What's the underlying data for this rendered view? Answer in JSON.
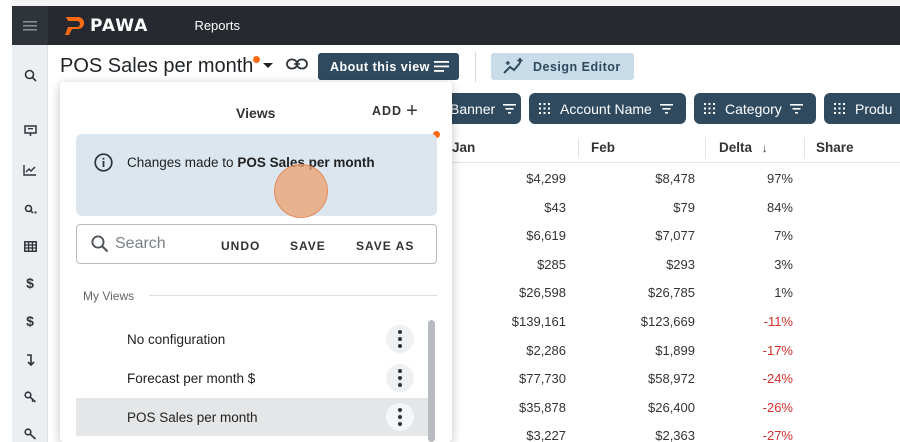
{
  "app": {
    "brand": "PAWA",
    "nav_reports": "Reports"
  },
  "header": {
    "title": "POS Sales per month",
    "about_label": "About this view",
    "design_label": "Design Editor"
  },
  "filters": [
    {
      "label": "Banner"
    },
    {
      "label": "Account Name"
    },
    {
      "label": "Category"
    },
    {
      "label": "Produ"
    }
  ],
  "table": {
    "headers": [
      "Jan",
      "Feb",
      "Delta",
      "Share"
    ],
    "sort_indicator": "↓",
    "rows": [
      {
        "jan": "$4,299",
        "feb": "$8,478",
        "delta": "97%",
        "negative": false
      },
      {
        "jan": "$43",
        "feb": "$79",
        "delta": "84%",
        "negative": false
      },
      {
        "jan": "$6,619",
        "feb": "$7,077",
        "delta": "7%",
        "negative": false
      },
      {
        "jan": "$285",
        "feb": "$293",
        "delta": "3%",
        "negative": false
      },
      {
        "jan": "$26,598",
        "feb": "$26,785",
        "delta": "1%",
        "negative": false
      },
      {
        "jan": "$139,161",
        "feb": "$123,669",
        "delta": "-11%",
        "negative": true
      },
      {
        "jan": "$2,286",
        "feb": "$1,899",
        "delta": "-17%",
        "negative": true
      },
      {
        "jan": "$77,730",
        "feb": "$58,972",
        "delta": "-24%",
        "negative": true
      },
      {
        "jan": "$35,878",
        "feb": "$26,400",
        "delta": "-26%",
        "negative": true
      },
      {
        "jan": "$3,227",
        "feb": "$2,363",
        "delta": "-27%",
        "negative": true
      }
    ]
  },
  "views_panel": {
    "title": "Views",
    "add_label": "ADD",
    "notice_prefix": "Changes made to ",
    "notice_view": "POS Sales per month",
    "undo_label": "UNDO",
    "save_label": "SAVE",
    "save_as_label": "SAVE AS",
    "search_placeholder": "Search",
    "section_label": "My Views",
    "items": [
      {
        "label": "No configuration",
        "active": false
      },
      {
        "label": "Forecast per month $",
        "active": false
      },
      {
        "label": "POS Sales per month",
        "active": true
      }
    ]
  },
  "colors": {
    "topbar": "#262a30",
    "primary_button": "#2f4a5f",
    "secondary_button": "#c9dcea",
    "accent_orange": "#ff6a13",
    "negative_red": "#d0302a",
    "notice_bg": "#dbe6ef"
  },
  "sidebar_icons": [
    "search-icon",
    "monitor-icon",
    "chart-line-icon",
    "search-small-icon",
    "table-icon",
    "dollar-icon",
    "dollar-icon",
    "arrow-down-icon",
    "key-icon",
    "key-icon"
  ]
}
